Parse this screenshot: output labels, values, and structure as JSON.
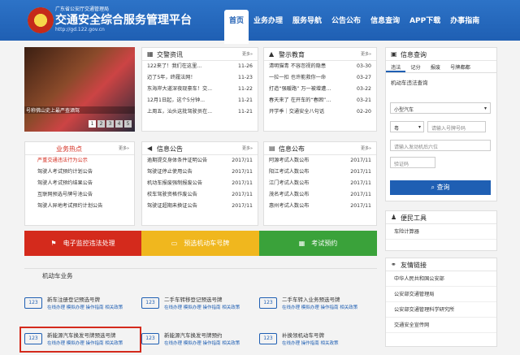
{
  "header": {
    "org": "广东省公安厅交通管理局",
    "title": "交通安全综合服务管理平台",
    "url": "http://gd.122.gov.cn",
    "nav": [
      "首页",
      "业务办理",
      "服务导航",
      "公告公布",
      "信息查询",
      "APP下载",
      "办事指南"
    ]
  },
  "photo": {
    "caption": "号称佛山史上最严查酒驾",
    "pages": [
      "1",
      "2",
      "3",
      "4",
      "5"
    ]
  },
  "news": {
    "title": "交警资讯",
    "more": "更多»",
    "items": [
      [
        "122来了！我们在这里...",
        "11-26"
      ],
      [
        "迈了5年，终履法网！",
        "11-23"
      ],
      [
        "东海岸大道深夜现豪车！交...",
        "11-22"
      ],
      [
        "12月1日起，这个5分钟...",
        "11-21"
      ],
      [
        "上周五，汕头这批驾驶员在...",
        "11-21"
      ]
    ]
  },
  "warn": {
    "title": "警示教育",
    "more": "更多»",
    "items": [
      [
        "清明猫青  不容忽视的隐患",
        "03-30"
      ],
      [
        "一拉一扣  也许能救你一命",
        "03-27"
      ],
      [
        "打造“强暖路”  万一被增遭…",
        "03-22"
      ],
      [
        "春天来了  在开车的“春困”…",
        "03-21"
      ],
      [
        "开学季｜交通安全八句话",
        "02-20"
      ]
    ]
  },
  "hot": {
    "title": "业务热点",
    "more": "更多»",
    "items": [
      "严重交通违法行为公示",
      "驾驶人考试预约计划公告",
      "驾驶人考试预约结果公告",
      "互联网预选号牌号池公告",
      "驾驶人异地考试预约计划公告"
    ]
  },
  "notice": {
    "title": "信息公告",
    "more": "更多»",
    "items": [
      [
        "逾期提交身体条件证明公告",
        "2017/11"
      ],
      [
        "驾驶证停止使用公告",
        "2017/11"
      ],
      [
        "机动车报废强制报废公告",
        "2017/11"
      ],
      [
        "校车驾驶资格作废公告",
        "2017/11"
      ],
      [
        "驾驶证超期未换证公告",
        "2017/11"
      ]
    ]
  },
  "publish": {
    "title": "信息公布",
    "more": "更多»",
    "items": [
      [
        "阿源考试人数公布",
        "2017/11"
      ],
      [
        "阳江考试人数公布",
        "2017/11"
      ],
      [
        "江门考试人数公布",
        "2017/11"
      ],
      [
        "茂名考试人数公布",
        "2017/11"
      ],
      [
        "惠州考试人数公布",
        "2017/11"
      ]
    ]
  },
  "bars": [
    "电子监控违法处理",
    "预选机动车号牌",
    "考试预约"
  ],
  "biz_section": "机动车业务",
  "biz": [
    {
      "name": "新车注册登记预选号牌",
      "links": "在线办理 模拟办理 操作指南 相关政策"
    },
    {
      "name": "二手车转移登记预选号牌",
      "links": "在线办理 模拟办理 操作指南 相关政策"
    },
    {
      "name": "二手车转入业务预选号牌",
      "links": "在线办理 模拟办理 操作指南 相关政策"
    },
    {
      "name": "新能源汽车换发号牌预选号牌",
      "links": "在线办理 模拟办理 操作指南 相关政策"
    },
    {
      "name": "新能源汽车换发号牌预约",
      "links": "在线办理 模拟办理 操作指南 相关政策"
    },
    {
      "name": "补换领机动车号牌",
      "links": "在线办理 操作指南 相关政策"
    }
  ],
  "query": {
    "title": "信息查询",
    "tabs": [
      "违法",
      "记分",
      "报废",
      "号牌都都"
    ],
    "sub": "机动车违法查询",
    "type": "小型汽车",
    "prov": "粤",
    "plate_ph": "请输入号牌号码",
    "engine_ph": "请输入发动机后六位",
    "code_ph": "验证码",
    "btn": "查询"
  },
  "tools": {
    "title": "便民工具",
    "items": [
      "车险计算器"
    ]
  },
  "links": {
    "title": "友情链接",
    "items": [
      "中华人民共和国公安部",
      "公安部交通管理局",
      "公安部交通管理科学研究所",
      "交通安全宣传网"
    ]
  },
  "colors": {
    "brand": "#1f5fb3",
    "red": "#d42a1c",
    "yellow": "#f0b71e",
    "green": "#3aa23a"
  }
}
